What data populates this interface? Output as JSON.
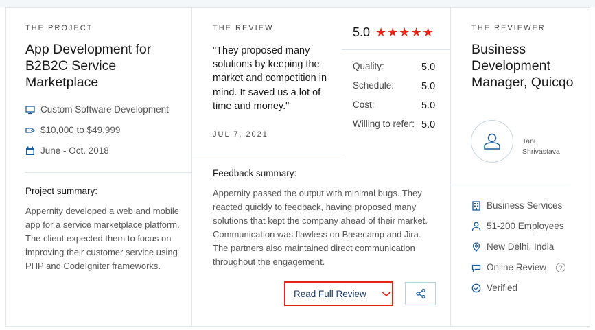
{
  "project": {
    "section_label": "THE PROJECT",
    "title": "App Development for B2B2C Service Marketplace",
    "service": "Custom Software Development",
    "budget": "$10,000 to $49,999",
    "timeline": "June - Oct. 2018",
    "summary_label": "Project summary:",
    "summary": "Appernity developed a web and mobile app for a service marketplace platform. The client expected them to focus on improving their customer service using PHP and CodeIgniter frameworks."
  },
  "review": {
    "section_label": "THE REVIEW",
    "quote": "\"They proposed many solutions by keeping the market and competition in mind. It saved us a lot of time and money.\"",
    "date": "JUL 7, 2021",
    "overall": "5.0",
    "stars": "★★★★★",
    "ratings": [
      {
        "label": "Quality:",
        "value": "5.0"
      },
      {
        "label": "Schedule:",
        "value": "5.0"
      },
      {
        "label": "Cost:",
        "value": "5.0"
      },
      {
        "label": "Willing to refer:",
        "value": "5.0"
      }
    ],
    "feedback_label": "Feedback summary:",
    "feedback": "Appernity passed the output with minimal bugs. They reacted quickly to feedback, having proposed many solutions that kept the company ahead of their market. Communication was flawless on Basecamp and Jira. The partners also maintained direct communication throughout the engagement.",
    "read_full_label": "Read Full Review"
  },
  "reviewer": {
    "section_label": "THE REVIEWER",
    "title": "Business Development Manager, Quicqo",
    "name": "Tanu Shrivastava",
    "industry": "Business Services",
    "employees": "51-200 Employees",
    "location": "New Delhi, India",
    "review_type": "Online Review",
    "help_glyph": "?",
    "verified": "Verified"
  },
  "colors": {
    "accent": "#e62415",
    "link": "#1a3a6c",
    "icon": "#1a5b9e"
  }
}
